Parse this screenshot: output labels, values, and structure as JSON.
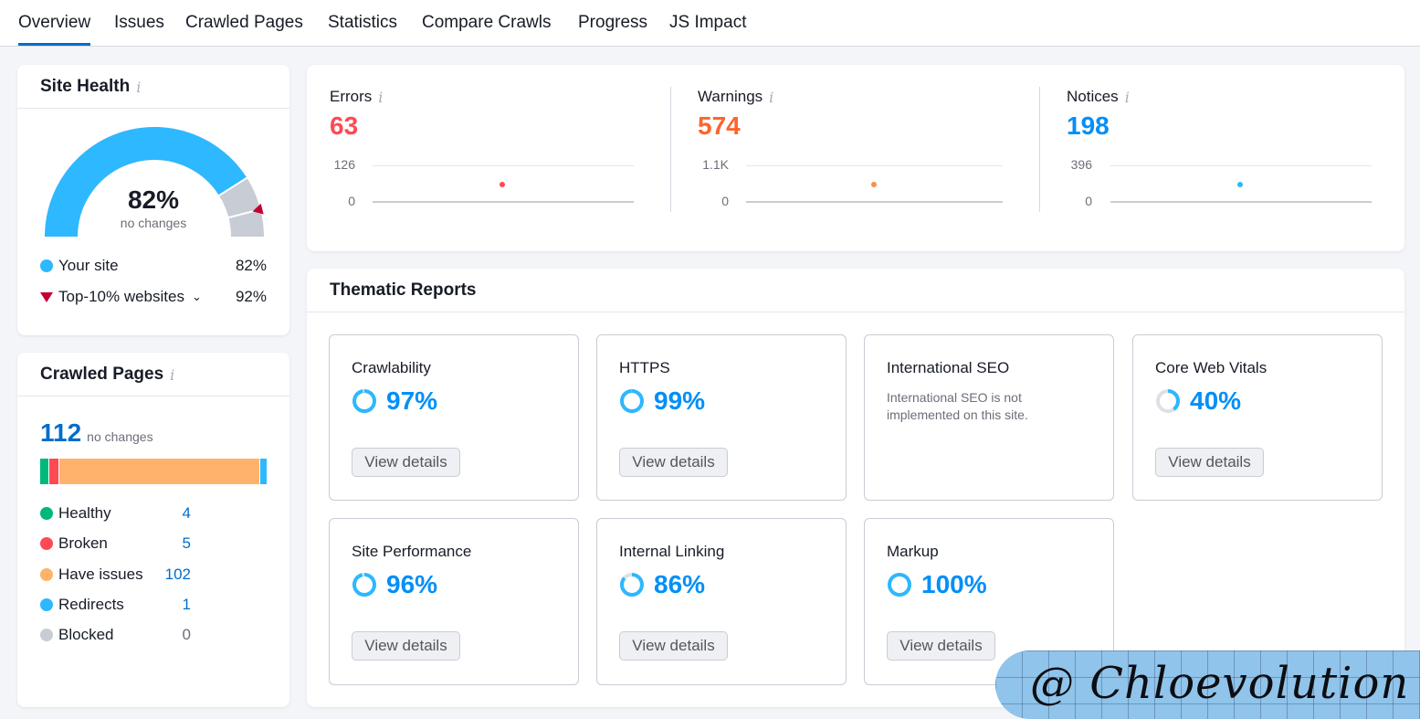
{
  "tabs": [
    "Overview",
    "Issues",
    "Crawled Pages",
    "Statistics",
    "Compare Crawls",
    "Progress",
    "JS Impact"
  ],
  "site_health": {
    "title": "Site Health",
    "score": "82%",
    "score_value": 82,
    "top_value": 92,
    "subtitle": "no changes",
    "legend": [
      {
        "label": "Your site",
        "value": "82%",
        "color": "#2db8ff"
      },
      {
        "label": "Top-10% websites",
        "value": "92%",
        "color": "#c40033"
      }
    ]
  },
  "crawled_pages": {
    "title": "Crawled Pages",
    "total": "112",
    "subtitle": "no changes",
    "breakdown": [
      {
        "label": "Healthy",
        "count": "4",
        "value": 4,
        "color": "#00b87a"
      },
      {
        "label": "Broken",
        "count": "5",
        "value": 5,
        "color": "#ff4953"
      },
      {
        "label": "Have issues",
        "count": "102",
        "value": 102,
        "color": "#ffb26b"
      },
      {
        "label": "Redirects",
        "count": "1",
        "value": 1,
        "color": "#2db8ff"
      },
      {
        "label": "Blocked",
        "count": "0",
        "value": 0,
        "color": "#c8ccd4"
      }
    ]
  },
  "issues": [
    {
      "label": "Errors",
      "value": "63",
      "color": "#ff4953",
      "axis_max": "126",
      "axis_min": "0"
    },
    {
      "label": "Warnings",
      "value": "574",
      "color": "#ff642d",
      "axis_max": "1.1K",
      "axis_min": "0"
    },
    {
      "label": "Notices",
      "value": "198",
      "color": "#008ff8",
      "axis_max": "396",
      "axis_min": "0"
    }
  ],
  "thematic": {
    "title": "Thematic Reports",
    "button_label": "View details",
    "reports": [
      {
        "name": "Crawlability",
        "pct": "97%",
        "value": 97
      },
      {
        "name": "HTTPS",
        "pct": "99%",
        "value": 99
      },
      {
        "name": "International SEO",
        "note": "International SEO is not implemented on this site."
      },
      {
        "name": "Core Web Vitals",
        "pct": "40%",
        "value": 40
      },
      {
        "name": "Site Performance",
        "pct": "96%",
        "value": 96
      },
      {
        "name": "Internal Linking",
        "pct": "86%",
        "value": 86
      },
      {
        "name": "Markup",
        "pct": "100%",
        "value": 100
      }
    ]
  },
  "watermark": "@ Chloevolution"
}
